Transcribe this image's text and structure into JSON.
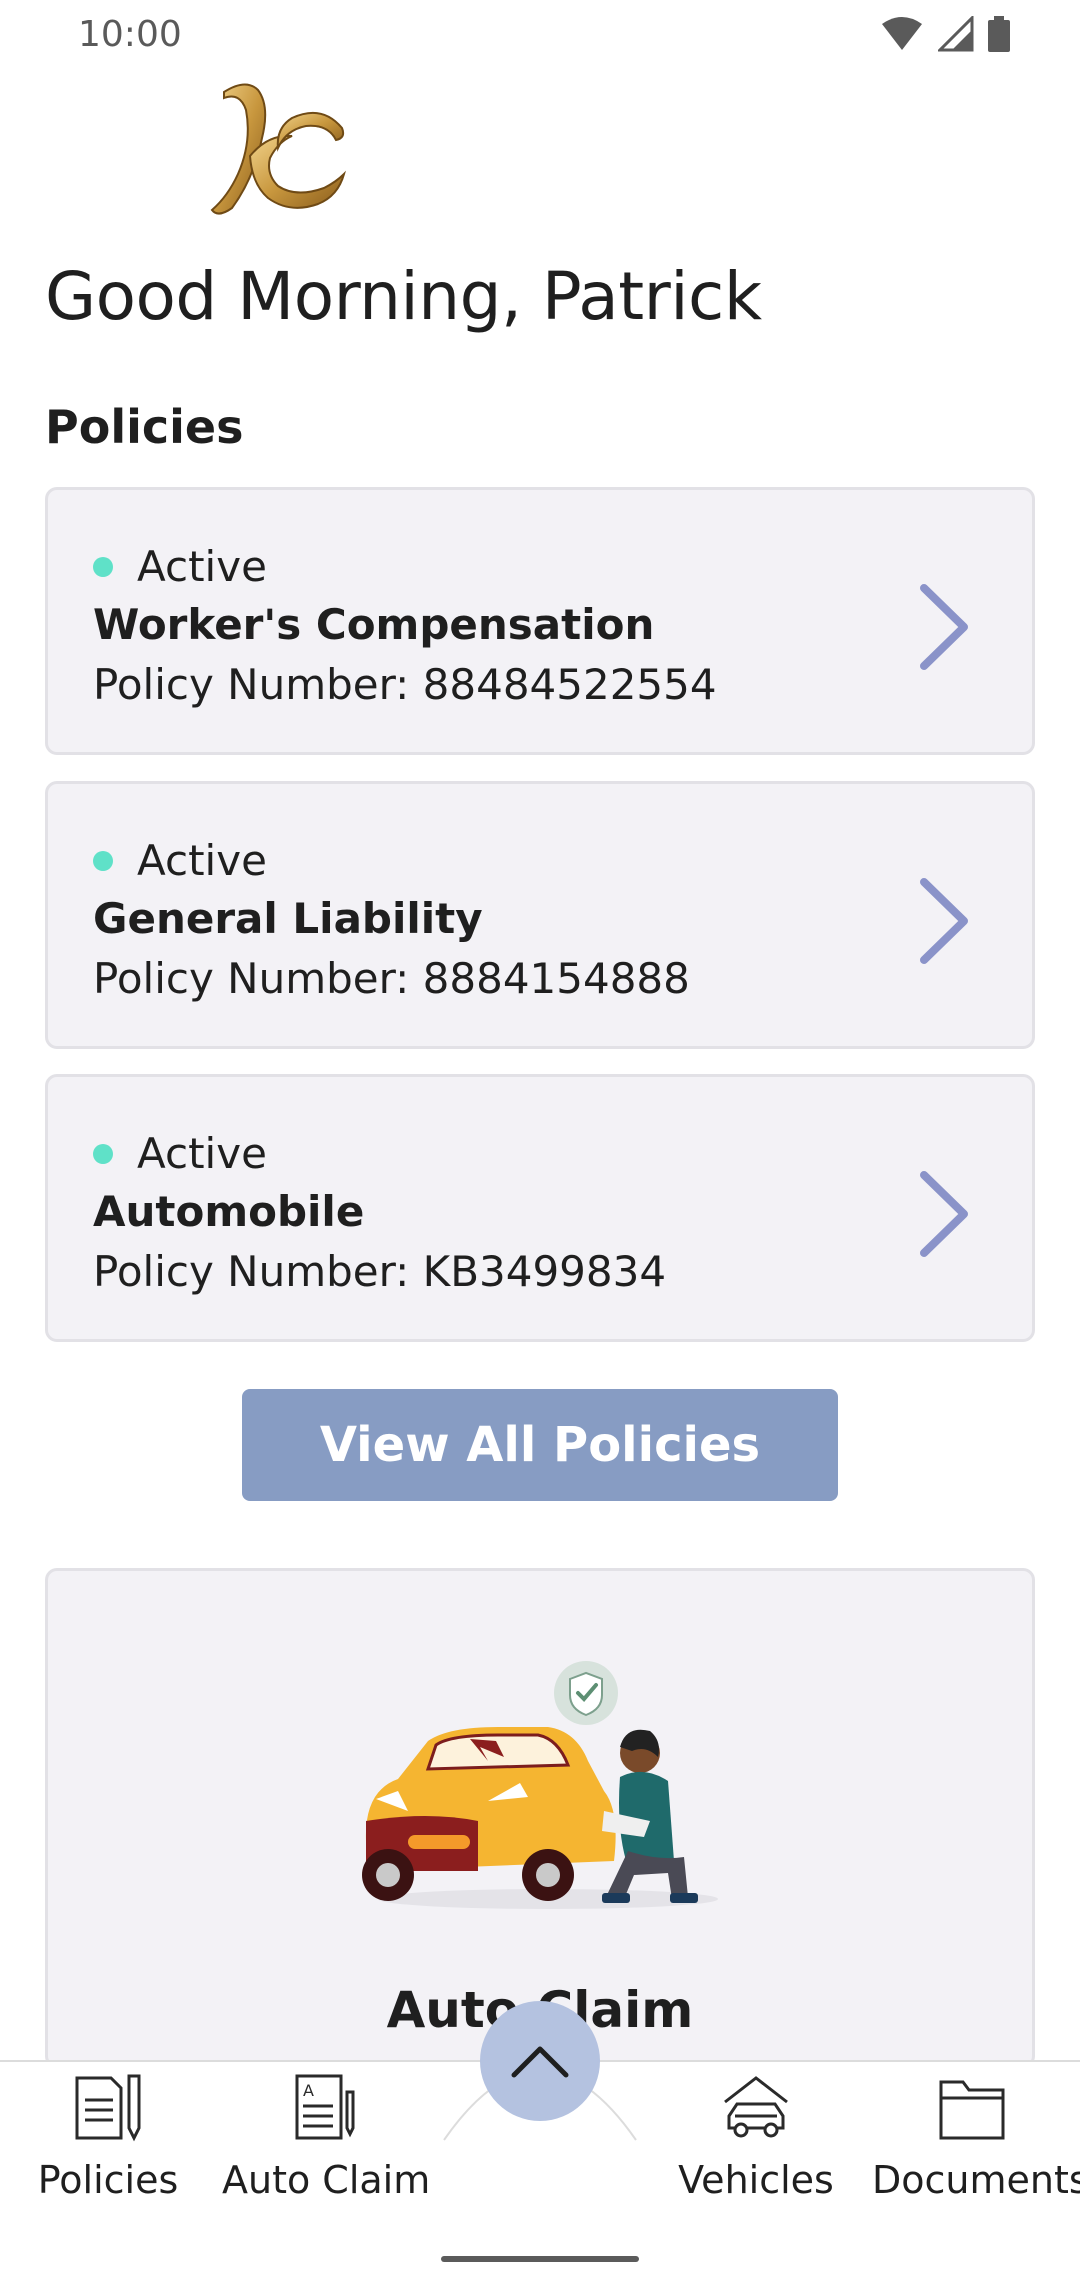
{
  "status_bar": {
    "time": "10:00"
  },
  "header": {
    "greeting": "Good Morning, Patrick"
  },
  "policies": {
    "section_title": "Policies",
    "items": [
      {
        "status": "Active",
        "name": "Worker's Compensation",
        "number_label": "Policy Number:",
        "number": "88484522554"
      },
      {
        "status": "Active",
        "name": "General Liability",
        "number_label": "Policy Number:",
        "number": "8884154888"
      },
      {
        "status": "Active",
        "name": "Automobile",
        "number_label": "Policy Number:",
        "number": "KB3499834"
      }
    ],
    "view_all_label": "View All Policies"
  },
  "claim_card": {
    "title": "Auto Claim"
  },
  "bottom_nav": {
    "items": [
      {
        "label": "Policies",
        "icon": "policies-document-pen-icon"
      },
      {
        "label": "Auto Claim",
        "icon": "claim-form-icon"
      },
      {
        "label": "Vehicles",
        "icon": "car-garage-icon"
      },
      {
        "label": "Documents",
        "icon": "folder-icon"
      }
    ],
    "fab_icon": "chevron-up-icon"
  },
  "colors": {
    "active_dot": "#5fe1c8",
    "button": "#879cc3",
    "fab": "#b4c2e0",
    "card_bg": "#f3f2f6",
    "chevron": "#8a93c9"
  }
}
